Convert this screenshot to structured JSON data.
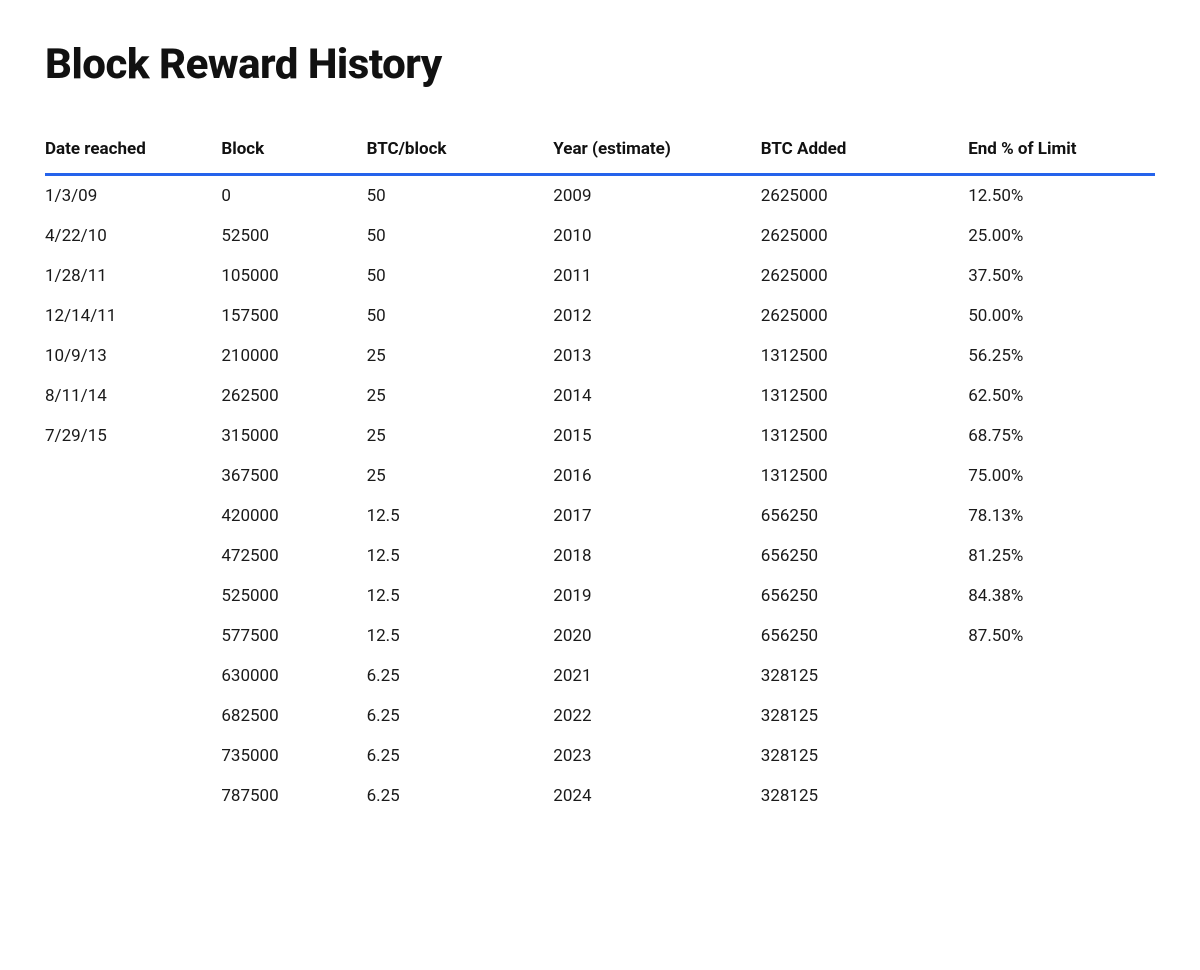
{
  "page": {
    "title": "Block Reward History"
  },
  "table": {
    "columns": [
      "Date reached",
      "Block",
      "BTC/block",
      "Year (estimate)",
      "BTC Added",
      "End % of Limit"
    ],
    "rows": [
      {
        "date": "1/3/09",
        "block": "0",
        "btc_per_block": "50",
        "year": "2009",
        "btc_added": "2625000",
        "end_pct": "12.50%"
      },
      {
        "date": "4/22/10",
        "block": "52500",
        "btc_per_block": "50",
        "year": "2010",
        "btc_added": "2625000",
        "end_pct": "25.00%"
      },
      {
        "date": "1/28/11",
        "block": "105000",
        "btc_per_block": "50",
        "year": "2011",
        "btc_added": "2625000",
        "end_pct": "37.50%"
      },
      {
        "date": "12/14/11",
        "block": "157500",
        "btc_per_block": "50",
        "year": "2012",
        "btc_added": "2625000",
        "end_pct": "50.00%"
      },
      {
        "date": "10/9/13",
        "block": "210000",
        "btc_per_block": "25",
        "year": "2013",
        "btc_added": "1312500",
        "end_pct": "56.25%"
      },
      {
        "date": "8/11/14",
        "block": "262500",
        "btc_per_block": "25",
        "year": "2014",
        "btc_added": "1312500",
        "end_pct": "62.50%"
      },
      {
        "date": "7/29/15",
        "block": "315000",
        "btc_per_block": "25",
        "year": "2015",
        "btc_added": "1312500",
        "end_pct": "68.75%"
      },
      {
        "date": "",
        "block": "367500",
        "btc_per_block": "25",
        "year": "2016",
        "btc_added": "1312500",
        "end_pct": "75.00%"
      },
      {
        "date": "",
        "block": "420000",
        "btc_per_block": "12.5",
        "year": "2017",
        "btc_added": "656250",
        "end_pct": "78.13%"
      },
      {
        "date": "",
        "block": "472500",
        "btc_per_block": "12.5",
        "year": "2018",
        "btc_added": "656250",
        "end_pct": "81.25%"
      },
      {
        "date": "",
        "block": "525000",
        "btc_per_block": "12.5",
        "year": "2019",
        "btc_added": "656250",
        "end_pct": "84.38%"
      },
      {
        "date": "",
        "block": "577500",
        "btc_per_block": "12.5",
        "year": "2020",
        "btc_added": "656250",
        "end_pct": "87.50%"
      },
      {
        "date": "",
        "block": "630000",
        "btc_per_block": "6.25",
        "year": "2021",
        "btc_added": "328125",
        "end_pct": ""
      },
      {
        "date": "",
        "block": "682500",
        "btc_per_block": "6.25",
        "year": "2022",
        "btc_added": "328125",
        "end_pct": ""
      },
      {
        "date": "",
        "block": "735000",
        "btc_per_block": "6.25",
        "year": "2023",
        "btc_added": "328125",
        "end_pct": ""
      },
      {
        "date": "",
        "block": "787500",
        "btc_per_block": "6.25",
        "year": "2024",
        "btc_added": "328125",
        "end_pct": ""
      }
    ]
  }
}
